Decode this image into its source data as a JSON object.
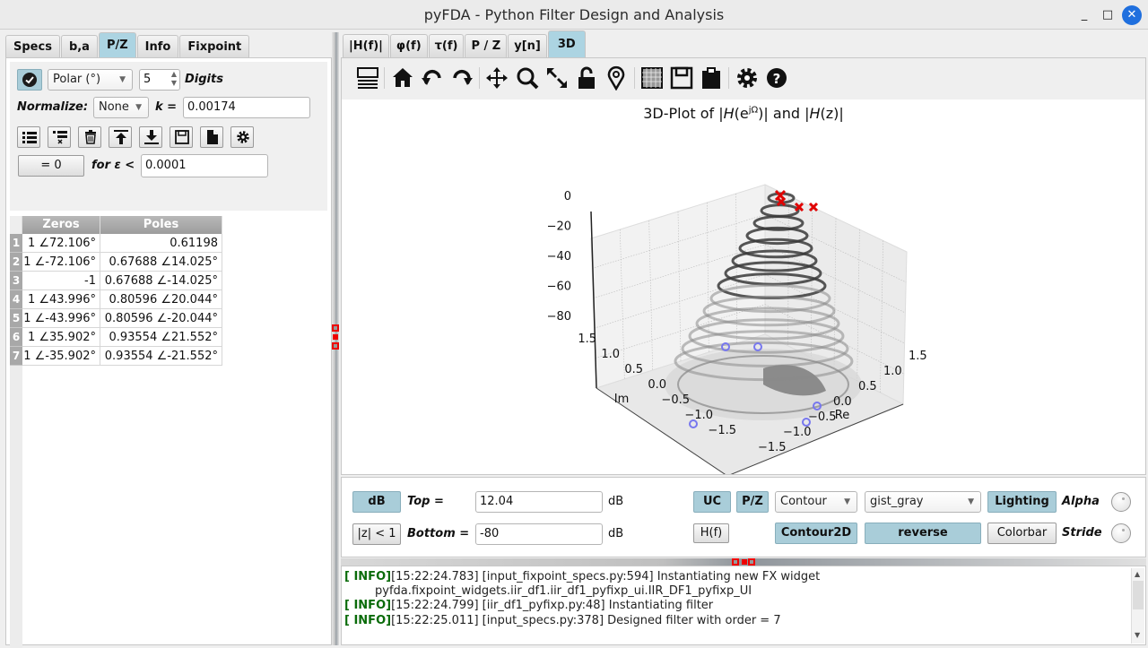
{
  "window": {
    "title": "pyFDA - Python Filter Design and Analysis",
    "minimize": "_",
    "maximize": "□",
    "close": "✕"
  },
  "left": {
    "tabs": [
      "Specs",
      "b,a",
      "P/Z",
      "Info",
      "Fixpoint"
    ],
    "active_tab": "P/Z",
    "format_select": "Polar (°)",
    "digits_value": "5",
    "digits_label": "Digits",
    "normalize_label": "Normalize:",
    "normalize_select": "None",
    "k_label": "k =",
    "k_value": "0.00174",
    "eq_zero_button": "= 0",
    "eps_label": "for ε <",
    "eps_value": "0.0001",
    "table": {
      "headers": [
        "Zeros",
        "Poles"
      ],
      "rows": [
        {
          "n": "1",
          "zero": "1 ∠72.106°",
          "pole": "0.61198"
        },
        {
          "n": "2",
          "zero": "1 ∠-72.106°",
          "pole": "0.67688 ∠14.025°"
        },
        {
          "n": "3",
          "zero": "-1",
          "pole": "0.67688 ∠-14.025°"
        },
        {
          "n": "4",
          "zero": "1 ∠43.996°",
          "pole": "0.80596 ∠20.044°"
        },
        {
          "n": "5",
          "zero": "1 ∠-43.996°",
          "pole": "0.80596 ∠-20.044°"
        },
        {
          "n": "6",
          "zero": "1 ∠35.902°",
          "pole": "0.93554 ∠21.552°"
        },
        {
          "n": "7",
          "zero": "1 ∠-35.902°",
          "pole": "0.93554 ∠-21.552°"
        }
      ]
    }
  },
  "right": {
    "tabs": [
      "|H(f)|",
      "φ(f)",
      "τ(f)",
      "P / Z",
      "y[n]",
      "3D"
    ],
    "active_tab": "3D",
    "toolbar_icons": [
      "layout-icon",
      "home-icon",
      "undo-icon",
      "redo-icon",
      "pan-icon",
      "zoom-icon",
      "fullscreen-icon",
      "lock-icon",
      "marker-icon",
      "grid-icon",
      "save-icon",
      "clipboard-icon",
      "settings-icon",
      "help-icon"
    ],
    "plot": {
      "title_prefix": "3D-Plot of |",
      "title_H1": "H",
      "title_e": "(e",
      "title_sup": "jΩ",
      "title_mid": ")| and |",
      "title_H2": "H",
      "title_z": "(z)|",
      "z_ticks": [
        "0",
        "−20",
        "−40",
        "−60",
        "−80"
      ],
      "im_ticks": [
        "1.5",
        "1.0",
        "0.5",
        "0.0",
        "−0.5",
        "−1.0",
        "−1.5"
      ],
      "re_ticks": [
        "1.5",
        "1.0",
        "0.5",
        "0.0",
        "−0.5",
        "−1.0",
        "−1.5"
      ],
      "im_label": "Im",
      "re_label": "Re"
    },
    "controls": {
      "db_button": "dB",
      "top_label": "Top =",
      "top_value": "12.04",
      "top_unit": "dB",
      "zlt1_button": "|z| < 1",
      "bottom_label": "Bottom =",
      "bottom_value": "-80",
      "bottom_unit": "dB",
      "uc_button": "UC",
      "pz_button": "P/Z",
      "hf_button": "H(f)",
      "plot_type_select": "Contour",
      "colormap_select": "gist_gray",
      "contour2d_button": "Contour2D",
      "reverse_button": "reverse",
      "lighting_button": "Lighting",
      "colorbar_button": "Colorbar",
      "alpha_label": "Alpha",
      "stride_label": "Stride"
    },
    "console": [
      {
        "level": "[ INFO]",
        "text": "[15:22:24.783] [input_fixpoint_specs.py:594] Instantiating new FX widget"
      },
      {
        "level": "",
        "text": "pyfda.fixpoint_widgets.iir_df1.iir_df1_pyfixp_ui.IIR_DF1_pyfixp_UI"
      },
      {
        "level": "[ INFO]",
        "text": "[15:22:24.799] [iir_df1_pyfixp.py:48] Instantiating filter"
      },
      {
        "level": "[ INFO]",
        "text": "[15:22:25.011] [input_specs.py:378] Designed filter with order = 7"
      }
    ]
  },
  "colors": {
    "active_tab": "#acd4e2",
    "toggle_on": "#a9cdd9",
    "log_level": "#0a6b0a",
    "pole_marker": "#e00000",
    "zero_marker": "#7777ee"
  }
}
